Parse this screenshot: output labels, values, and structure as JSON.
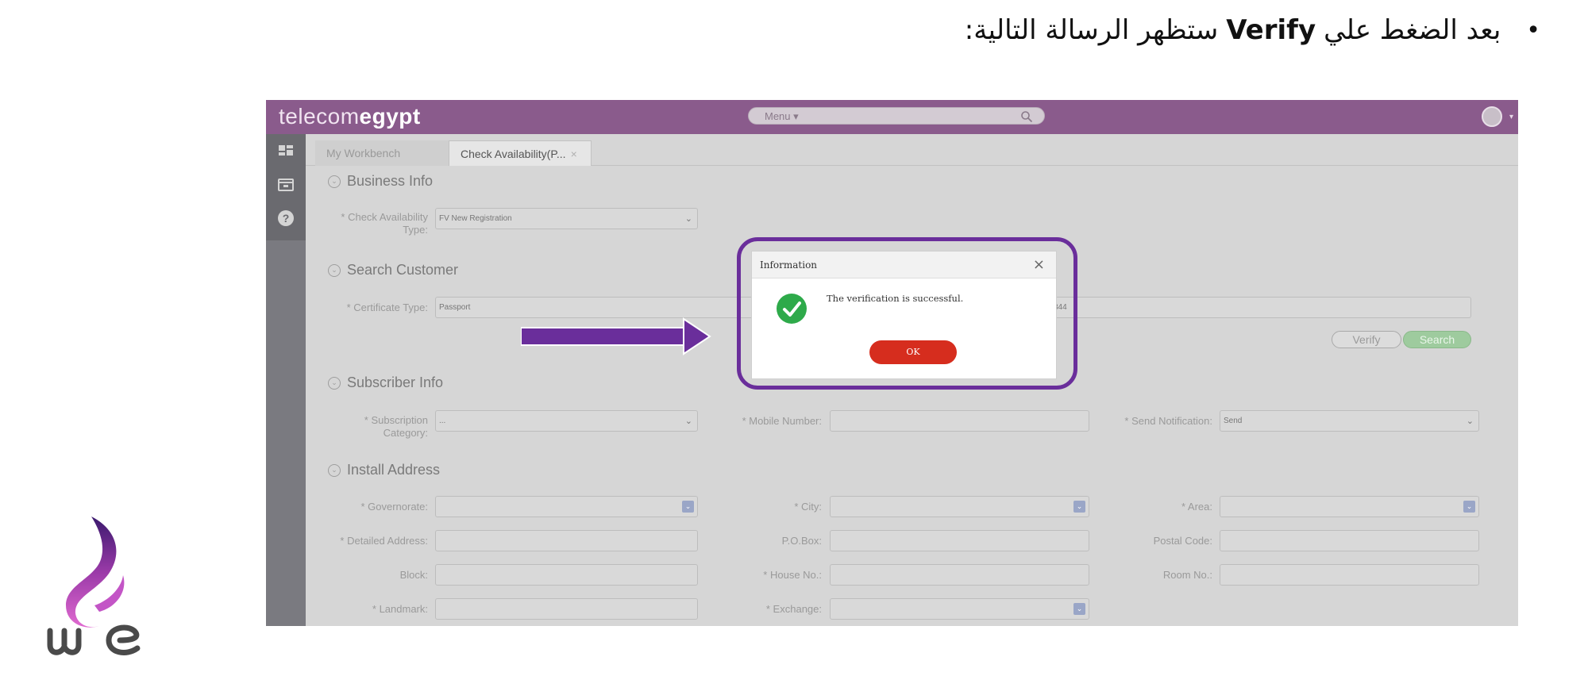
{
  "heading": {
    "bullet": "•",
    "text_before": "بعد الضغط علي",
    "bold_word": "Verify",
    "text_after": "ستظهر الرسالة التالية:"
  },
  "app": {
    "logo_light": "telecom",
    "logo_bold": "egypt",
    "menu_label": "Menu ▾",
    "tabs": [
      {
        "label": "My Workbench"
      },
      {
        "label": "Check Availability(P...",
        "close": "×"
      }
    ],
    "business_info": {
      "title": "Business Info",
      "check_type_label": "* Check Availability Type:",
      "check_type_value": "FV New Registration"
    },
    "search_customer": {
      "title": "Search Customer",
      "certificate_type_label": "* Certificate Type:",
      "certificate_type_value": "Passport",
      "certificate_no_fragment": "344",
      "verify_label": "Verify",
      "search_label": "Search"
    },
    "subscriber_info": {
      "title": "Subscriber Info",
      "subscription_category_label": "* Subscription Category:",
      "subscription_category_value": "...",
      "mobile_number_label": "* Mobile Number:",
      "send_notification_label": "* Send Notification:",
      "send_notification_value": "Send"
    },
    "install_address": {
      "title": "Install Address",
      "governorate_label": "* Governorate:",
      "city_label": "* City:",
      "area_label": "* Area:",
      "detailed_address_label": "* Detailed Address:",
      "po_box_label": "P.O.Box:",
      "postal_code_label": "Postal Code:",
      "block_label": "Block:",
      "house_no_label": "* House No.:",
      "room_no_label": "Room No.:",
      "landmark_label": "* Landmark:",
      "exchange_label": "* Exchange:"
    },
    "dialog": {
      "title": "Information",
      "close": "×",
      "message": "The verification is successful.",
      "ok_label": "OK"
    }
  },
  "colors": {
    "brand_purple": "#8a5b8c",
    "highlight_purple": "#6a2e9b",
    "ok_red": "#d62d1e",
    "success_green": "#2eaa4a"
  }
}
